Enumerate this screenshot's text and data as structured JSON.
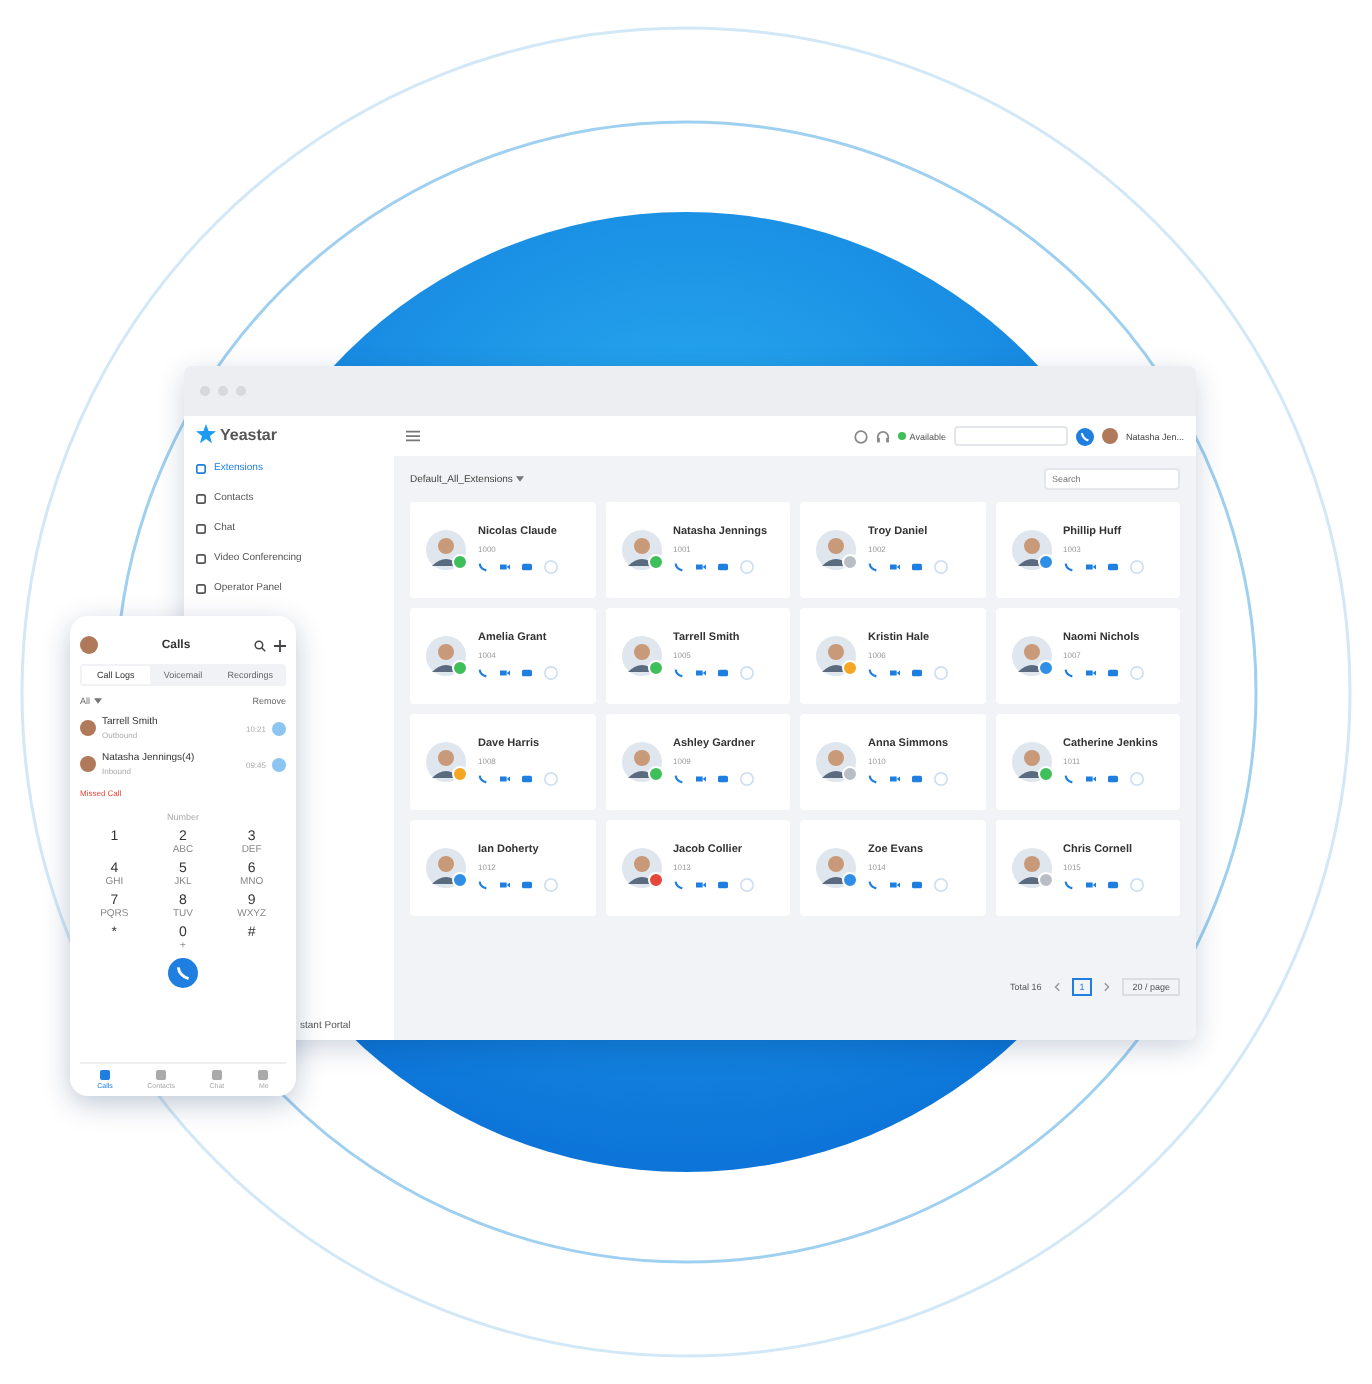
{
  "app": {
    "logo": "Yeastar",
    "nav": [
      {
        "label": "Extensions",
        "selected": true
      },
      {
        "label": "Contacts",
        "selected": false
      },
      {
        "label": "Chat",
        "selected": false
      },
      {
        "label": "Video Conferencing",
        "selected": false
      },
      {
        "label": "Operator Panel",
        "selected": false
      }
    ],
    "nav_footer": "stant Portal"
  },
  "topbar": {
    "presence": "Available",
    "user": "Natasha Jen..."
  },
  "filter": {
    "label": "Default_All_Extensions",
    "search": {
      "placeholder": "Search"
    }
  },
  "contacts": [
    {
      "name": "Nicolas Claude",
      "ext": "1000",
      "color": "#3fbf5a"
    },
    {
      "name": "Natasha Jennings",
      "ext": "1001",
      "color": "#3fbf5a"
    },
    {
      "name": "Troy Daniel",
      "ext": "1002",
      "color": "#b9bec6"
    },
    {
      "name": "Phillip Huff",
      "ext": "1003",
      "color": "#2f8ee6"
    },
    {
      "name": "Amelia Grant",
      "ext": "1004",
      "color": "#3fbf5a"
    },
    {
      "name": "Tarrell Smith",
      "ext": "1005",
      "color": "#3fbf5a"
    },
    {
      "name": "Kristin Hale",
      "ext": "1006",
      "color": "#f5a623"
    },
    {
      "name": "Naomi Nichols",
      "ext": "1007",
      "color": "#2f8ee6"
    },
    {
      "name": "Dave Harris",
      "ext": "1008",
      "color": "#f5a623"
    },
    {
      "name": "Ashley Gardner",
      "ext": "1009",
      "color": "#3fbf5a"
    },
    {
      "name": "Anna Simmons",
      "ext": "1010",
      "color": "#b9bec6"
    },
    {
      "name": "Catherine Jenkins",
      "ext": "1011",
      "color": "#3fbf5a"
    },
    {
      "name": "Ian Doherty",
      "ext": "1012",
      "color": "#2f8ee6"
    },
    {
      "name": "Jacob Collier",
      "ext": "1013",
      "color": "#e5483b"
    },
    {
      "name": "Zoe Evans",
      "ext": "1014",
      "color": "#2f8ee6"
    },
    {
      "name": "Chris Cornell",
      "ext": "1015",
      "color": "#b9bec6"
    }
  ],
  "pagination": {
    "total": "Total 16",
    "page": "1",
    "per_page": "20 / page"
  },
  "phone": {
    "title": "Calls",
    "tabs": [
      {
        "label": "Call Logs",
        "selected": true
      },
      {
        "label": "Voicemail",
        "selected": false
      },
      {
        "label": "Recordings",
        "selected": false
      }
    ],
    "filter": "All",
    "remove": "Remove",
    "calls": [
      {
        "name": "Tarrell Smith",
        "detail": "Outbound",
        "time": "10:21",
        "kind": "normal"
      },
      {
        "name": "Natasha Jennings(4)",
        "detail": "Inbound",
        "time": "09:45",
        "kind": "normal"
      },
      {
        "name": "Missed Call",
        "kind": "missed"
      }
    ],
    "number_placeholder": "Number",
    "keys": [
      {
        "digit": "1"
      },
      {
        "digit": "2",
        "letters": "ABC"
      },
      {
        "digit": "3",
        "letters": "DEF"
      },
      {
        "digit": "4",
        "letters": "GHI"
      },
      {
        "digit": "5",
        "letters": "JKL"
      },
      {
        "digit": "6",
        "letters": "MNO"
      },
      {
        "digit": "7",
        "letters": "PQRS"
      },
      {
        "digit": "8",
        "letters": "TUV"
      },
      {
        "digit": "9",
        "letters": "WXYZ"
      },
      {
        "digit": "*"
      },
      {
        "digit": "0",
        "letters": "+"
      },
      {
        "digit": "#"
      }
    ],
    "bottom_tabs": [
      {
        "label": "Calls",
        "selected": true
      },
      {
        "label": "Contacts",
        "selected": false
      },
      {
        "label": "Chat",
        "selected": false
      },
      {
        "label": "Me",
        "selected": false
      }
    ]
  }
}
